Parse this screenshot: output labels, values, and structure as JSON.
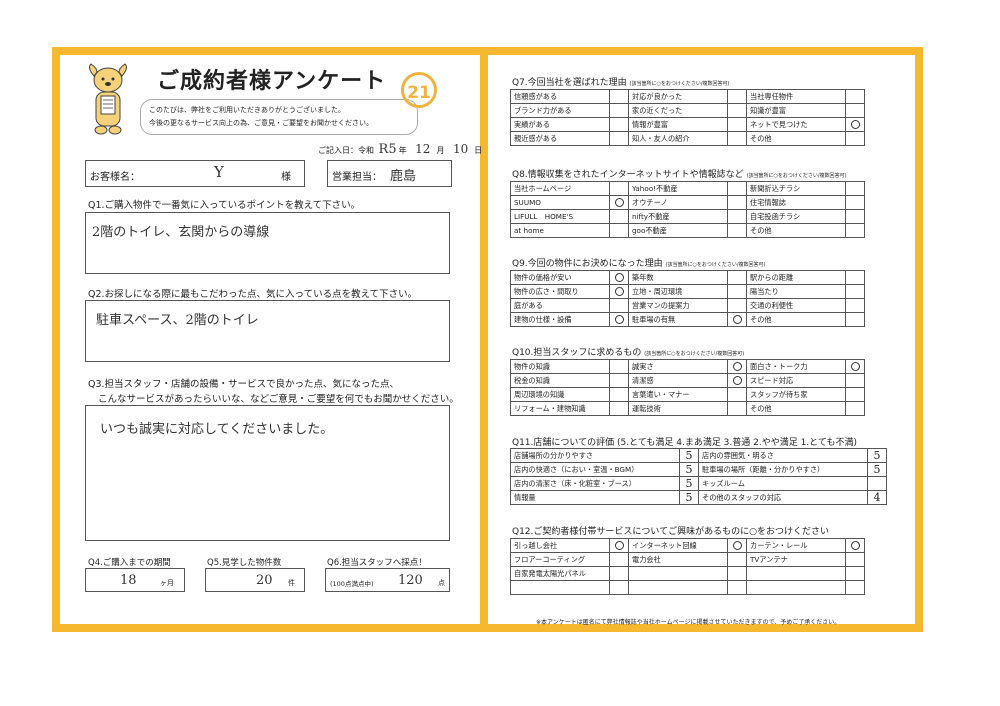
{
  "header": {
    "title": "ご成約者様アンケート",
    "greeting_line1": "このたびは、弊社をご利用いただきありがとうございました。",
    "greeting_line2": "今後の更なるサービス向上の為、ご意見・ご要望をお聞かせください。",
    "logo_text": "21",
    "date_label": "ご記入日：令和",
    "date_year": "R5",
    "date_year_unit": "年",
    "date_month": "12",
    "date_month_unit": "月",
    "date_day": "10",
    "date_day_unit": "日"
  },
  "customer": {
    "name_label": "お客様名：",
    "name_value": "Y",
    "name_suffix": "様",
    "staff_label": "営業担当：",
    "staff_value": "鹿島"
  },
  "q1": {
    "label": "Q1.ご購入物件で一番気に入っているポイントを教えて下さい。",
    "answer": "2階のトイレ、玄関からの導線"
  },
  "q2": {
    "label": "Q2.お探しになる際に最もこだわった点、気に入っている点を教えて下さい。",
    "answer": "駐車スペース、2階のトイレ"
  },
  "q3": {
    "label1": "Q3.担当スタッフ・店舗の設備・サービスで良かった点、気になった点、",
    "label2": "こんなサービスがあったらいいな、などご意見・ご要望を何でもお聞かせください。",
    "answer": "いつも誠実に対応してくださいました。"
  },
  "q4": {
    "label": "Q4.ご購入までの期間",
    "value": "18",
    "unit": "ヶ月"
  },
  "q5": {
    "label": "Q5.見学した物件数",
    "value": "20",
    "unit": "件"
  },
  "q6": {
    "label": "Q6.担当スタッフへ採点！",
    "note": "(100点満点中)",
    "value": "120",
    "unit": "点"
  },
  "q7": {
    "label": "Q7.今回当社を選ばれた理由",
    "note": "(該当箇所に○をおつけください/複数回答可)",
    "rows": [
      [
        {
          "t": "信頼感がある",
          "m": ""
        },
        {
          "t": "対応が良かった",
          "m": ""
        },
        {
          "t": "当社専任物件",
          "m": ""
        }
      ],
      [
        {
          "t": "ブランド力がある",
          "m": ""
        },
        {
          "t": "家の近くだった",
          "m": ""
        },
        {
          "t": "知識が豊富",
          "m": ""
        }
      ],
      [
        {
          "t": "実績がある",
          "m": ""
        },
        {
          "t": "情報が豊富",
          "m": ""
        },
        {
          "t": "ネットで見つけた",
          "m": "O"
        }
      ],
      [
        {
          "t": "親近感がある",
          "m": ""
        },
        {
          "t": "知人・友人の紹介",
          "m": ""
        },
        {
          "t": "その他",
          "m": ""
        }
      ]
    ]
  },
  "q8": {
    "label": "Q8.情報収集をされたインターネットサイトや情報誌など",
    "note": "(該当箇所に○をおつけください/複数回答可)",
    "rows": [
      [
        {
          "t": "当社ホームページ",
          "m": ""
        },
        {
          "t": "Yahoo!不動産",
          "m": ""
        },
        {
          "t": "新聞折込チラシ",
          "m": ""
        }
      ],
      [
        {
          "t": "SUUMO",
          "m": "O"
        },
        {
          "t": "オウチーノ",
          "m": ""
        },
        {
          "t": "住宅情報誌",
          "m": ""
        }
      ],
      [
        {
          "t": "LIFULL　HOME'S",
          "m": ""
        },
        {
          "t": "nifty不動産",
          "m": ""
        },
        {
          "t": "自宅投函チラシ",
          "m": ""
        }
      ],
      [
        {
          "t": "at home",
          "m": ""
        },
        {
          "t": "goo不動産",
          "m": ""
        },
        {
          "t": "その他",
          "m": ""
        }
      ]
    ]
  },
  "q9": {
    "label": "Q9.今回の物件にお決めになった理由",
    "note": "(該当箇所に○をおつけください/複数回答可)",
    "rows": [
      [
        {
          "t": "物件の価格が安い",
          "m": "O"
        },
        {
          "t": "築年数",
          "m": ""
        },
        {
          "t": "駅からの距離",
          "m": ""
        }
      ],
      [
        {
          "t": "物件の広さ・間取り",
          "m": "O"
        },
        {
          "t": "立地・周辺環境",
          "m": ""
        },
        {
          "t": "陽当たり",
          "m": ""
        }
      ],
      [
        {
          "t": "庭がある",
          "m": ""
        },
        {
          "t": "営業マンの提案力",
          "m": ""
        },
        {
          "t": "交通の利便性",
          "m": ""
        }
      ],
      [
        {
          "t": "建物の仕様・設備",
          "m": "O"
        },
        {
          "t": "駐車場の有無",
          "m": "O"
        },
        {
          "t": "その他",
          "m": ""
        }
      ]
    ]
  },
  "q10": {
    "label": "Q10.担当スタッフに求めるもの",
    "note": "(該当箇所に○をおつけください/複数回答可)",
    "rows": [
      [
        {
          "t": "物件の知識",
          "m": ""
        },
        {
          "t": "誠実さ",
          "m": "O"
        },
        {
          "t": "面白さ・トーク力",
          "m": "O"
        }
      ],
      [
        {
          "t": "税金の知識",
          "m": ""
        },
        {
          "t": "清潔感",
          "m": "O"
        },
        {
          "t": "スピード対応",
          "m": ""
        }
      ],
      [
        {
          "t": "周辺環境の知識",
          "m": ""
        },
        {
          "t": "言葉遣い・マナー",
          "m": ""
        },
        {
          "t": "スタッフが待ち家",
          "m": ""
        }
      ],
      [
        {
          "t": "リフォーム・建物知識",
          "m": ""
        },
        {
          "t": "運転技術",
          "m": ""
        },
        {
          "t": "その他",
          "m": ""
        }
      ]
    ]
  },
  "q11": {
    "label": "Q11.店舗についての評価 (5.とても満足 4.まあ満足 3.普通 2.やや満足 1.とても不満)",
    "rows": [
      [
        {
          "t": "店舗場所の分かりやすさ",
          "m": "5"
        },
        {
          "t": "店内の雰囲気・明るさ",
          "m": "5"
        }
      ],
      [
        {
          "t": "店内の快適さ（におい・室温・BGM）",
          "m": "5"
        },
        {
          "t": "駐車場の場所（距離・分かりやすさ）",
          "m": "5"
        }
      ],
      [
        {
          "t": "店内の清潔さ（床・化粧室・ブース）",
          "m": "5"
        },
        {
          "t": "キッズルーム",
          "m": ""
        }
      ],
      [
        {
          "t": "情報量",
          "m": "5"
        },
        {
          "t": "その他のスタッフの対応",
          "m": "4"
        }
      ]
    ]
  },
  "q12": {
    "label": "Q12.ご契約者様付帯サービスについてご興味があるものに○をおつけください",
    "rows": [
      [
        {
          "t": "引っ越し会社",
          "m": "O"
        },
        {
          "t": "インターネット回線",
          "m": "O"
        },
        {
          "t": "カーテン・レール",
          "m": "O"
        }
      ],
      [
        {
          "t": "フロアーコーティング",
          "m": ""
        },
        {
          "t": "電力会社",
          "m": ""
        },
        {
          "t": "TVアンテナ",
          "m": ""
        }
      ],
      [
        {
          "t": "自家発電太陽光パネル",
          "m": ""
        },
        {
          "t": "",
          "m": ""
        },
        {
          "t": "",
          "m": ""
        }
      ],
      [
        {
          "t": "",
          "m": ""
        },
        {
          "t": "",
          "m": ""
        },
        {
          "t": "",
          "m": ""
        }
      ]
    ]
  },
  "footer": "※本アンケートは匿名にて弊社情報誌や当社ホームページに掲載させていただきますので、予めご了承ください。",
  "colors": {
    "frame": "#f5b82e",
    "logo": "#f0b340"
  }
}
